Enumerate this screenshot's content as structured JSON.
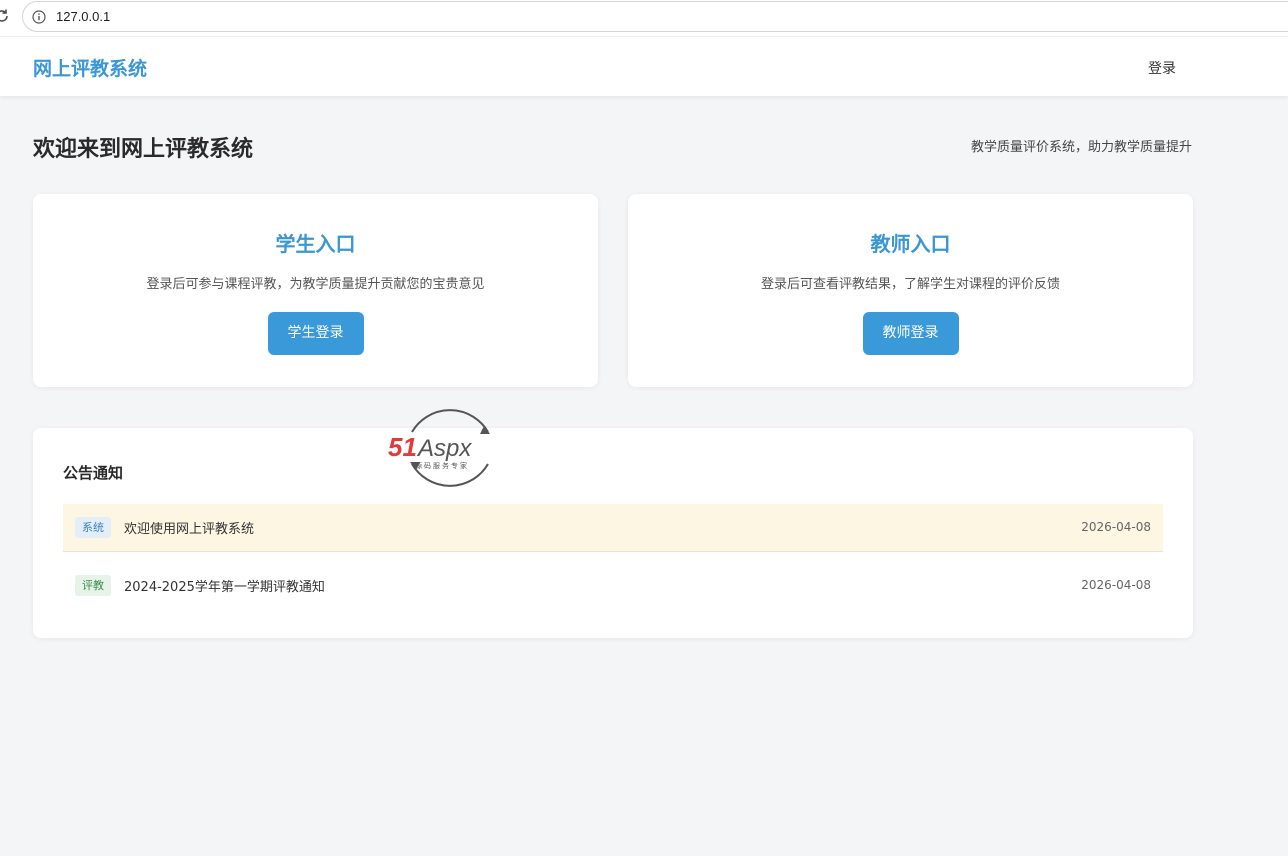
{
  "browser": {
    "url": "127.0.0.1"
  },
  "header": {
    "brand": "网上评教系统",
    "login_link": "登录"
  },
  "hero": {
    "title": "欢迎来到网上评教系统",
    "tagline": "教学质量评价系统，助力教学质量提升"
  },
  "cards": [
    {
      "title": "学生入口",
      "description": "登录后可参与课程评教，为教学质量提升贡献您的宝贵意见",
      "button": "学生登录"
    },
    {
      "title": "教师入口",
      "description": "登录后可查看评教结果，了解学生对课程的评价反馈",
      "button": "教师登录"
    }
  ],
  "notices": {
    "title": "公告通知",
    "items": [
      {
        "tag": "系统",
        "text": "欢迎使用网上评教系统",
        "date": "2026-04-08"
      },
      {
        "tag": "评教",
        "text": "2024-2025学年第一学期评教通知",
        "date": "2026-04-08"
      }
    ]
  },
  "watermark": {
    "brand": "51Aspx",
    "subtitle": "源码服务专家"
  },
  "colors": {
    "accent": "#3a96d4",
    "button": "#3a9ad9",
    "highlight_row": "#fdf6e3"
  }
}
